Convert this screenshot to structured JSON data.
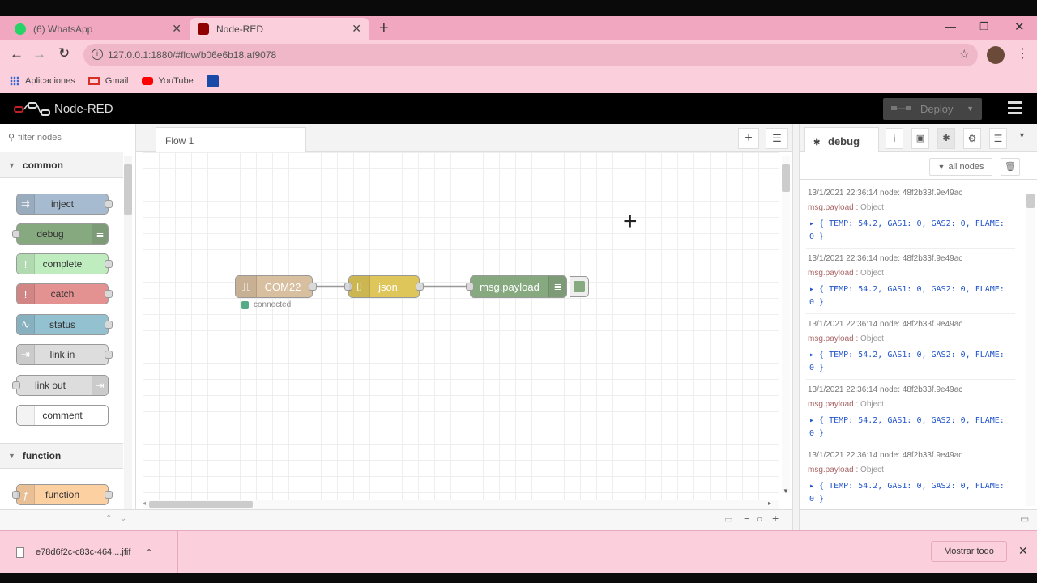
{
  "browser": {
    "tabs": [
      {
        "label": "(6) WhatsApp",
        "icon": "whatsapp-icon"
      },
      {
        "label": "Node-RED",
        "icon": "node-red-icon"
      }
    ],
    "url": "127.0.0.1:1880/#flow/b06e6b18.af9078",
    "bookmarks": [
      {
        "label": "Aplicaciones",
        "icon": "apps-grid-icon"
      },
      {
        "label": "Gmail",
        "icon": "gmail-icon"
      },
      {
        "label": "YouTube",
        "icon": "youtube-icon"
      }
    ]
  },
  "nodered": {
    "title": "Node-RED",
    "deploy_label": "Deploy"
  },
  "palette": {
    "filter_placeholder": "filter nodes",
    "categories": [
      {
        "label": "common"
      },
      {
        "label": "function"
      }
    ],
    "nodes": [
      {
        "label": "inject",
        "color": "#a6bbcf"
      },
      {
        "label": "debug",
        "color": "#87a980"
      },
      {
        "label": "complete",
        "color": "#c0edc0"
      },
      {
        "label": "catch",
        "color": "#e49191"
      },
      {
        "label": "status",
        "color": "#94c1d0"
      },
      {
        "label": "link in",
        "color": "#dddddd"
      },
      {
        "label": "link out",
        "color": "#dddddd"
      },
      {
        "label": "comment",
        "color": "#ffffff"
      },
      {
        "label": "function",
        "color": "#fdd0a2"
      }
    ]
  },
  "workspace": {
    "tab_label": "Flow 1",
    "flow_nodes": [
      {
        "label": "COM22",
        "color": "#d8bfa0",
        "status": "connected"
      },
      {
        "label": "json",
        "color": "#dec65a"
      },
      {
        "label": "msg.payload",
        "color": "#87a980"
      }
    ]
  },
  "sidebar": {
    "tab_label": "debug",
    "filter_label": "all nodes",
    "messages": [
      {
        "meta": "13/1/2021 22:36:14   node: 48f2b33f.9e49ac",
        "topic": "msg.payload",
        "type": "Object",
        "payload": "{ TEMP: 54.2, GAS1: 0, GAS2: 0, FLAME: 0 }"
      },
      {
        "meta": "13/1/2021 22:36:14   node: 48f2b33f.9e49ac",
        "topic": "msg.payload",
        "type": "Object",
        "payload": "{ TEMP: 54.2, GAS1: 0, GAS2: 0, FLAME: 0 }"
      },
      {
        "meta": "13/1/2021 22:36:14   node: 48f2b33f.9e49ac",
        "topic": "msg.payload",
        "type": "Object",
        "payload": "{ TEMP: 54.2, GAS1: 0, GAS2: 0, FLAME: 0 }"
      },
      {
        "meta": "13/1/2021 22:36:14   node: 48f2b33f.9e49ac",
        "topic": "msg.payload",
        "type": "Object",
        "payload": "{ TEMP: 54.2, GAS1: 0, GAS2: 0, FLAME: 0 }"
      },
      {
        "meta": "13/1/2021 22:36:14   node: 48f2b33f.9e49ac",
        "topic": "msg.payload",
        "type": "Object",
        "payload": "{ TEMP: 54.2, GAS1: 0, GAS2: 0, FLAME: 0 }"
      }
    ]
  },
  "downloads": {
    "file_name": "e78d6f2c-c83c-464....jfif",
    "show_all_label": "Mostrar todo"
  }
}
